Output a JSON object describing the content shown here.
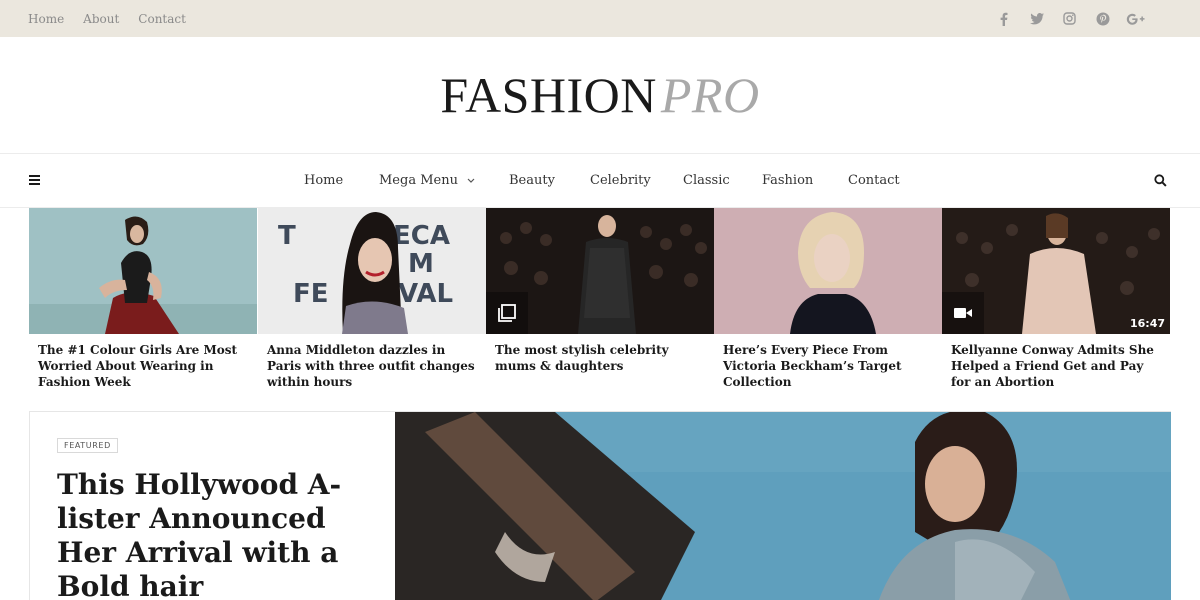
{
  "topbar": {
    "links": [
      "Home",
      "About",
      "Contact"
    ],
    "social_icons": [
      "facebook-icon",
      "twitter-icon",
      "instagram-icon",
      "pinterest-icon",
      "google-plus-icon"
    ]
  },
  "logo": {
    "part1": "FASHION",
    "part2": "PRO"
  },
  "nav": {
    "items": [
      "Home",
      "Mega Menu",
      "Beauty",
      "Celebrity",
      "Classic",
      "Fashion",
      "Contact"
    ],
    "menu_icon": "hamburger-icon",
    "search_icon": "search-icon"
  },
  "posts": [
    {
      "title": "The #1 Colour Girls Are Most Worried About Wearing in Fashion Week"
    },
    {
      "title": "Anna Middleton dazzles in Paris with three outfit changes within hours"
    },
    {
      "title": "The most stylish celebrity mums & daughters",
      "badge": "gallery-icon"
    },
    {
      "title": "Here’s Every Piece From Victoria Beckham’s Target Collection"
    },
    {
      "title": "Kellyanne Conway Admits She Helped a Friend Get and Pay for an Abortion",
      "badge": "video-camera-icon",
      "duration": "16:47"
    }
  ],
  "thumb_sign_text": [
    "T",
    "ECA",
    "M",
    "FE",
    "VAL"
  ],
  "featured": {
    "tag": "FEATURED",
    "headline": "This Hollywood A-lister Announced Her Arrival with a Bold hair"
  },
  "colors": {
    "topbar_bg": "#ebe7de",
    "logo_dark": "#1a1a1a",
    "logo_light": "#a9a9a9",
    "hero_sky": "#5f9fbd"
  }
}
